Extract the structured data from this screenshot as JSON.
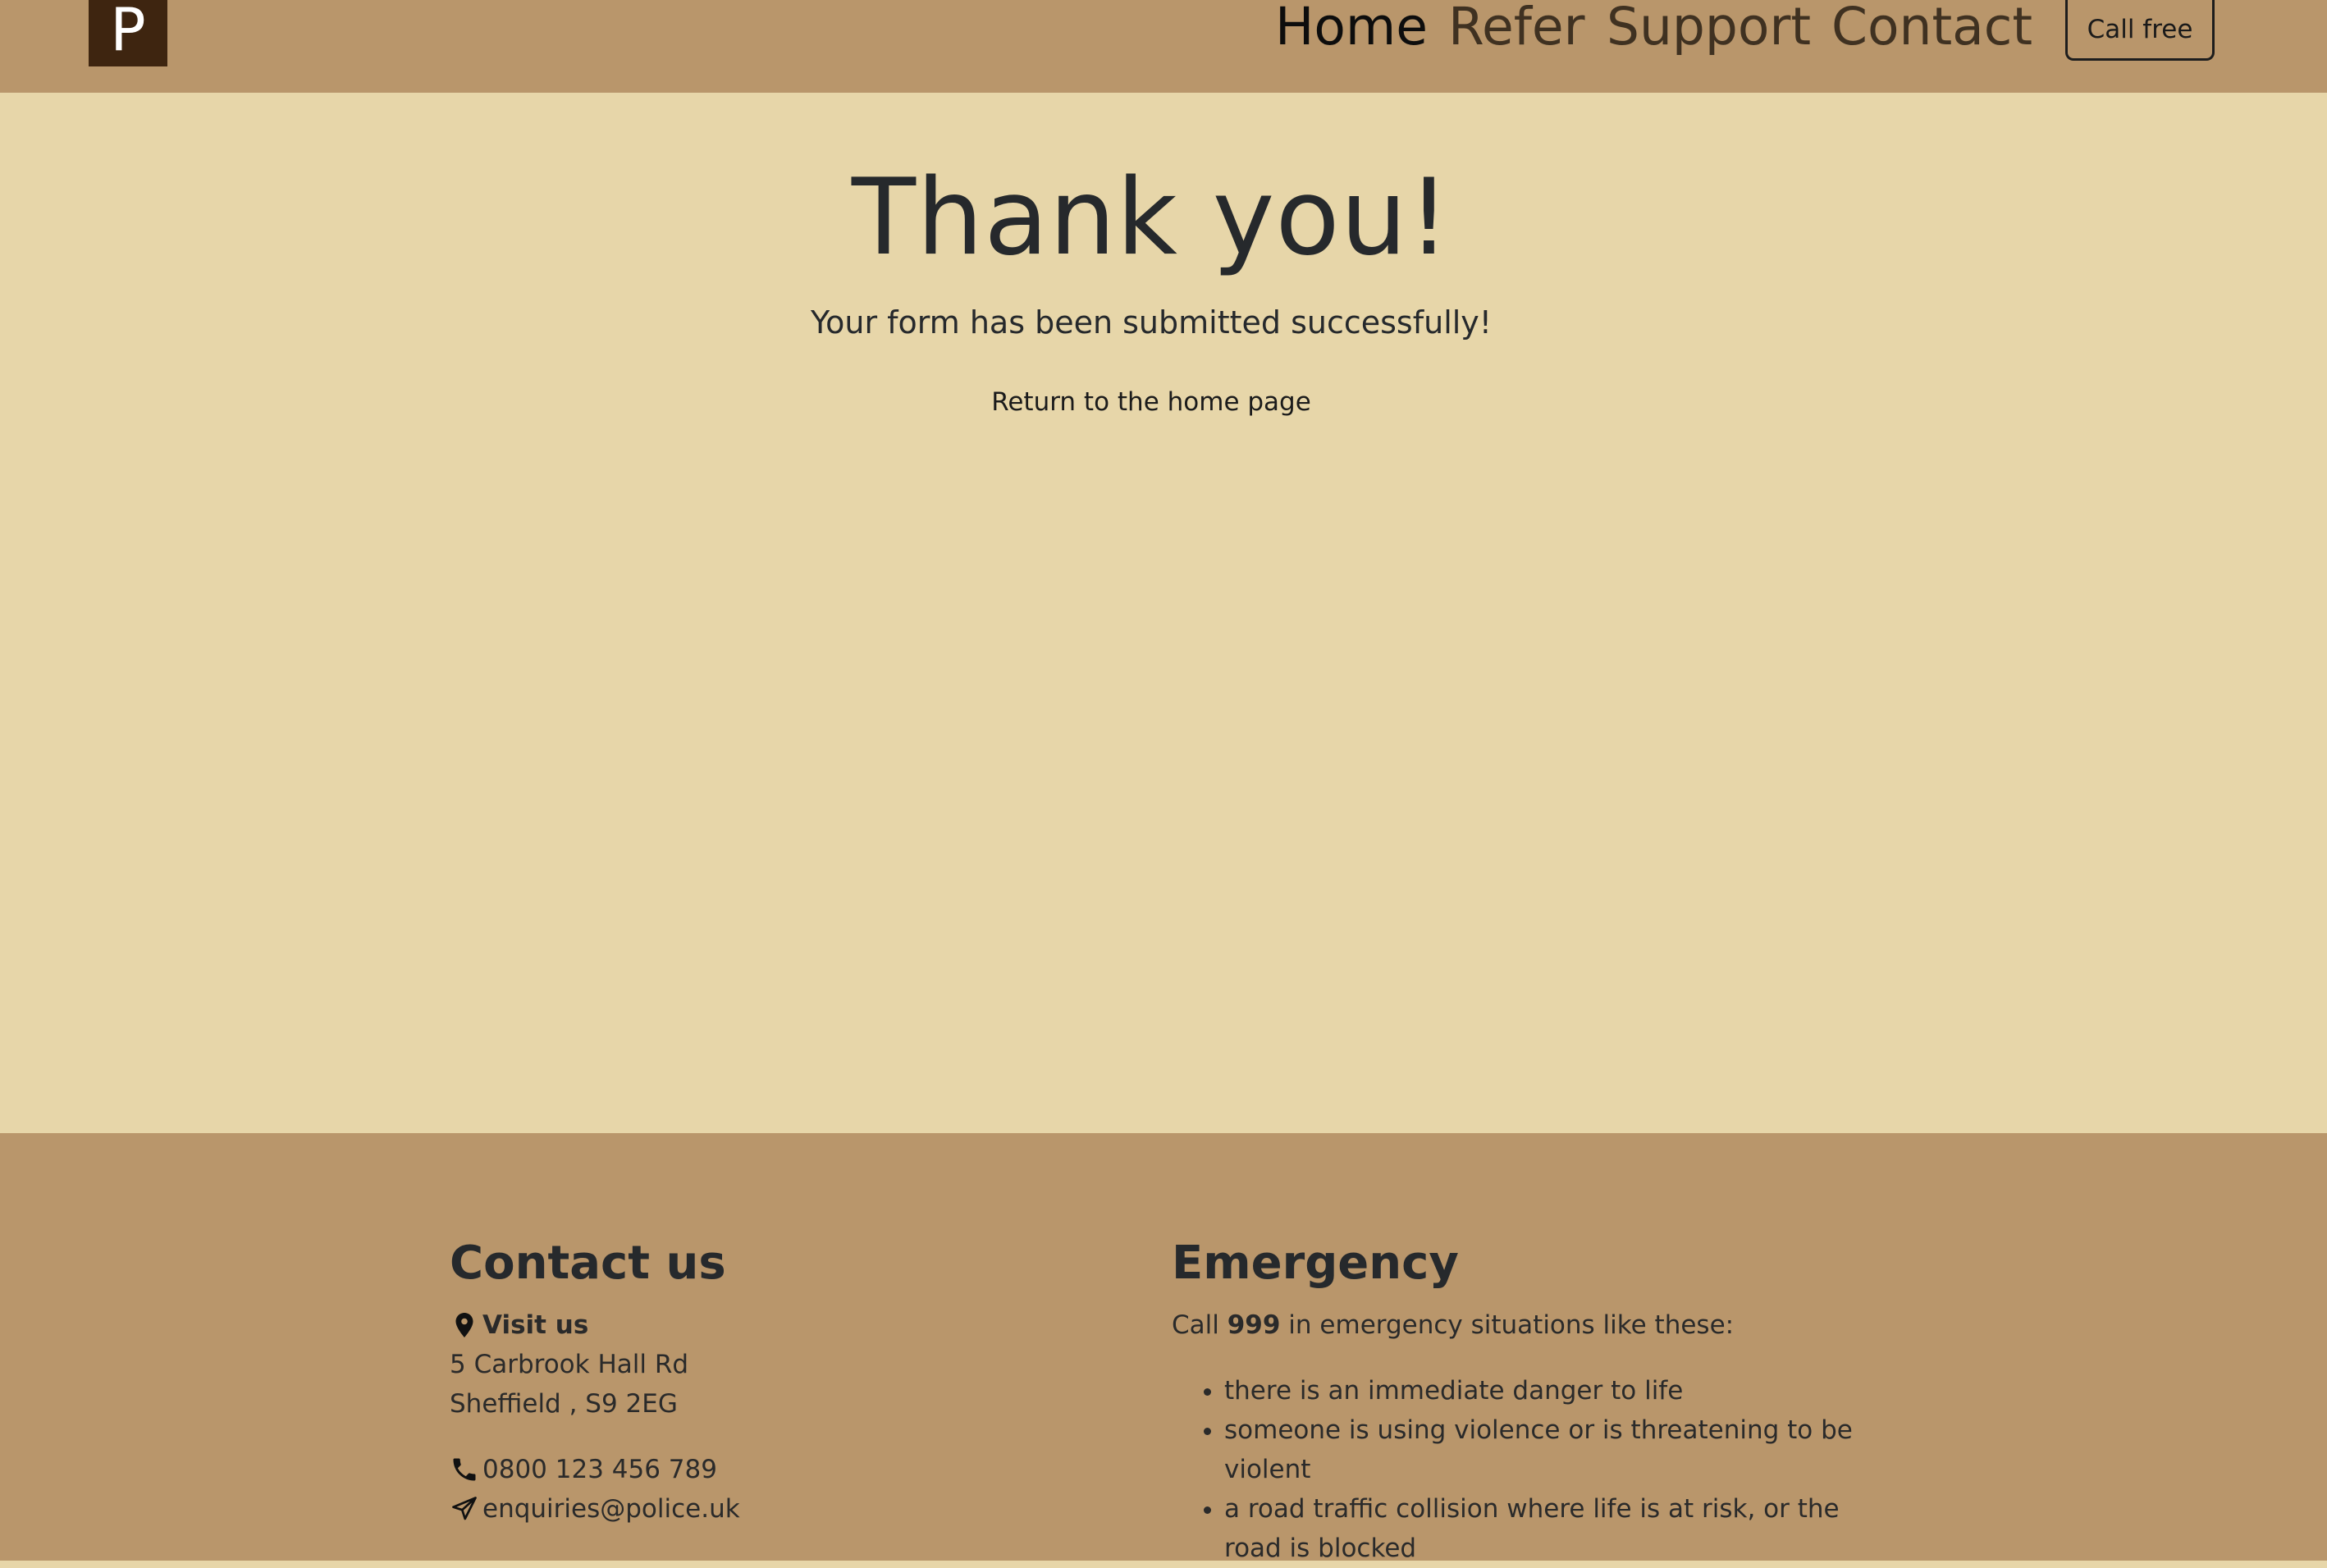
{
  "header": {
    "logo_letter": "P",
    "nav": [
      {
        "label": "Home",
        "active": true
      },
      {
        "label": "Refer",
        "active": false
      },
      {
        "label": "Support",
        "active": false
      },
      {
        "label": "Contact",
        "active": false
      }
    ],
    "call_button": "Call free"
  },
  "main": {
    "heading": "Thank you!",
    "subtitle": "Your form has been submitted successfully!",
    "return_link": "Return to the home page"
  },
  "footer": {
    "contact": {
      "title": "Contact us",
      "visit_label": "Visit us",
      "address_line1": "5 Carbrook Hall Rd",
      "address_line2": "Sheffield , S9 2EG",
      "phone": "0800 123 456 789",
      "email": "enquiries@police.uk"
    },
    "emergency": {
      "title": "Emergency",
      "intro_before": "Call ",
      "intro_number": "999",
      "intro_after": " in emergency situations like these:",
      "items": [
        "there is an immediate danger to life",
        "someone is using violence or is threatening to be violent",
        "a road traffic collision where life is at risk, or the road is blocked"
      ]
    }
  },
  "colors": {
    "header_bg": "#b9966b",
    "page_bg": "#e7d6a9",
    "logo_bg": "#3e2510",
    "text": "#26292c"
  },
  "icons": {
    "visit": "map-pin-icon",
    "phone": "phone-icon",
    "email": "send-icon"
  }
}
